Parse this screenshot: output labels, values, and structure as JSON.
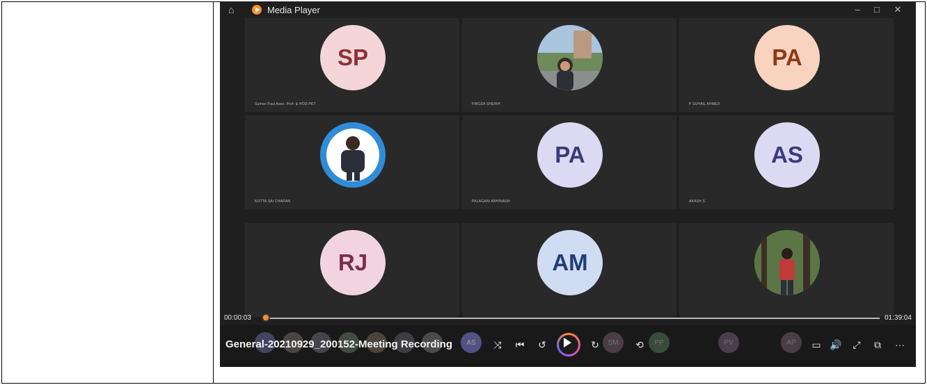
{
  "window": {
    "title": "Media Player",
    "minimize": "–",
    "restore": "□",
    "close": "✕"
  },
  "tiles": [
    {
      "initials": "SP",
      "name": "Suman Paul Asso. Prof. & HOD-PET",
      "bg": "#f5d6d8",
      "fg": "#8e2f3a",
      "photo": false
    },
    {
      "initials": "",
      "name": "FIROZA SHEIKH",
      "bg": "#9fb6c9",
      "fg": "#fff",
      "photo": true
    },
    {
      "initials": "PA",
      "name": "P SUHAIL AHMED",
      "bg": "#f8d3c0",
      "fg": "#8a3b16",
      "photo": false
    },
    {
      "initials": "",
      "name": "KOTTA SAI CHARAN",
      "bg": "#2e8cd9",
      "fg": "#fff",
      "photo": true
    },
    {
      "initials": "PA",
      "name": "PALAGANI ABHINASH",
      "bg": "#dcdaf2",
      "fg": "#3b3a7a",
      "photo": false
    },
    {
      "initials": "AS",
      "name": "AKASH S",
      "bg": "#dcdaf2",
      "fg": "#3b3a7a",
      "photo": false
    },
    {
      "initials": "RJ",
      "name": "",
      "bg": "#f1d4e0",
      "fg": "#7a2d4c",
      "photo": false
    },
    {
      "initials": "AM",
      "name": "",
      "bg": "#cfdcf2",
      "fg": "#1f3f74",
      "photo": false
    },
    {
      "initials": "",
      "name": "",
      "bg": "#4f6b3a",
      "fg": "#fff",
      "photo": true
    }
  ],
  "playback": {
    "elapsed": "00:00:03",
    "total": "01:39:04",
    "progress_fraction": 0.001
  },
  "file_title": "General-20210929_200152-Meeting Recording",
  "controls": {
    "shuffle": "⤨",
    "previous": "⏮",
    "rewind": "↺",
    "forward": "↻",
    "repeat": "⟲",
    "captions": "▭",
    "volume": "🔊",
    "fullscreen": "⤢",
    "miniplayer": "⧉",
    "more": "···"
  },
  "ghost_avatars": [
    "AS",
    "SM",
    "PP",
    "PV",
    "AP"
  ]
}
